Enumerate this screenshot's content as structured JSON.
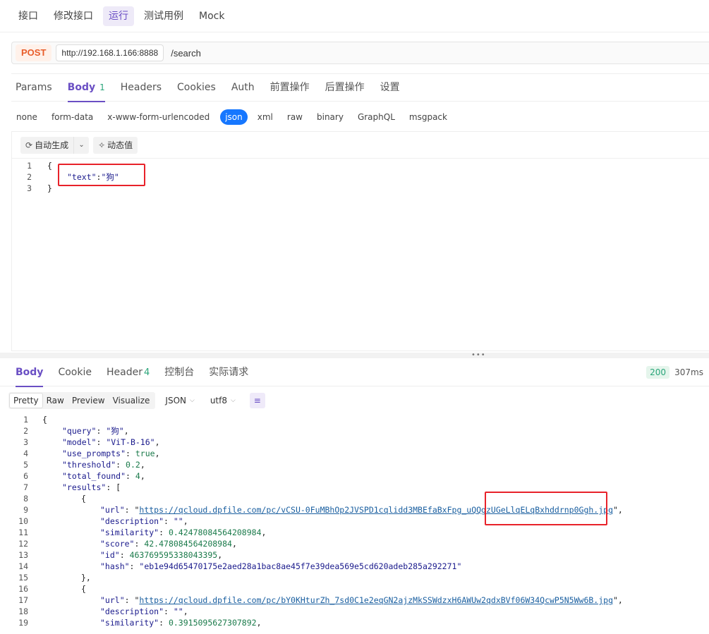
{
  "top_tabs": [
    {
      "label": "接口"
    },
    {
      "label": "修改接口"
    },
    {
      "label": "运行"
    },
    {
      "label": "测试用例"
    },
    {
      "label": "Mock"
    }
  ],
  "request": {
    "method": "POST",
    "host": "http://192.168.1.166:8888",
    "path": "/search"
  },
  "request_tabs": {
    "params": "Params",
    "body": "Body",
    "body_count": "1",
    "headers": "Headers",
    "cookies": "Cookies",
    "auth": "Auth",
    "pre": "前置操作",
    "post": "后置操作",
    "settings": "设置"
  },
  "body_types": [
    "none",
    "form-data",
    "x-www-form-urlencoded",
    "json",
    "xml",
    "raw",
    "binary",
    "GraphQL",
    "msgpack"
  ],
  "editor_toolbar": {
    "auto_generate": "自动生成",
    "dynamic_value": "动态值"
  },
  "request_body": {
    "lines": [
      "1",
      "2",
      "3"
    ],
    "open": "{",
    "key": "\"text\"",
    "colon": ":",
    "value": "\"狗\"",
    "close": "}"
  },
  "response_tabs": {
    "body": "Body",
    "cookie": "Cookie",
    "header": "Header",
    "header_count": "4",
    "console": "控制台",
    "actual_request": "实际请求"
  },
  "response_status": {
    "code": "200",
    "time": "307ms"
  },
  "response_tools": {
    "pretty": "Pretty",
    "raw": "Raw",
    "preview": "Preview",
    "visualize": "Visualize",
    "format": "JSON",
    "encoding": "utf8"
  },
  "response_body": {
    "l1": "{",
    "query_key": "\"query\"",
    "query_val": "\"狗\"",
    "model_key": "\"model\"",
    "model_val": "\"ViT-B-16\"",
    "use_prompts_key": "\"use_prompts\"",
    "use_prompts_val": "true",
    "threshold_key": "\"threshold\"",
    "threshold_val": "0.2",
    "total_found_key": "\"total_found\"",
    "total_found_val": "4",
    "results_key": "\"results\"",
    "results_open": "[",
    "obj_open": "{",
    "url_key": "\"url\"",
    "url1": "https://qcloud.dpfile.com/pc/vCSU-0FuMBhOp2JVSPD1cqlidd3MBEfaBxFpg_uQQgzUGeLlqELqBxhddrnp0Ggh.jpg",
    "description_key": "\"description\"",
    "description_val": "\"\"",
    "similarity_key": "\"similarity\"",
    "similarity1": "0.42478084564208984",
    "score_key": "\"score\"",
    "score1": "42.478084564208984",
    "id_key": "\"id\"",
    "id1": "463769595338043395",
    "hash_key": "\"hash\"",
    "hash1": "\"eb1e94d65470175e2aed28a1bac8ae45f7e39dea569e5cd620adeb285a292271\"",
    "obj_close": "},",
    "url2": "https://qcloud.dpfile.com/pc/bY0KHturZh_7sd0C1e2eqGN2ajzMkSSWdzxH6AWUw2qdxBVf06W34QcwP5N5Ww6B.jpg",
    "similarity2": "0.3915095627307892"
  }
}
